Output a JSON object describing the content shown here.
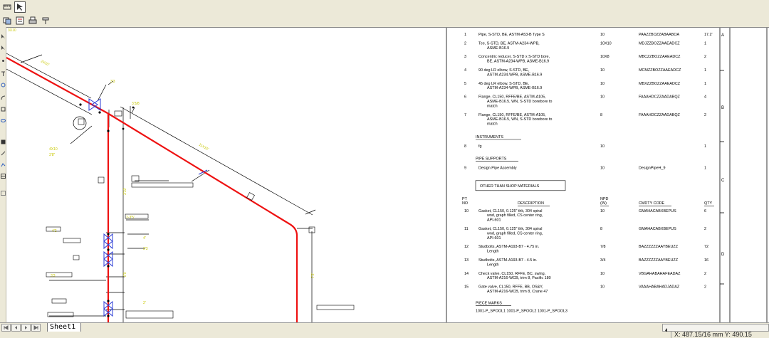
{
  "toolbar_top": {
    "icons": [
      "ruler-icon",
      "select-arrow-icon"
    ]
  },
  "toolbar_second": {
    "icons": [
      "layers-icon",
      "properties-icon",
      "print-icon",
      "pin-icon"
    ]
  },
  "sheet_tab": "Sheet1",
  "coordinates": "X: 487.15/16 mm   Y: 490.15",
  "iso_labels": [
    "3X10",
    "2X10'",
    "11X10'",
    "4X10",
    "3'3",
    "3'3/8",
    "3'8\"",
    "3'10'",
    "2-3'5'",
    "4'2",
    "4'",
    "3'3",
    "2'0",
    "3'3",
    "2'",
    "7'2'"
  ],
  "callouts": [
    "3",
    "5",
    "6",
    "12",
    "1",
    "7",
    "13",
    "14",
    "9",
    "11",
    "2"
  ],
  "bom": {
    "rows": [
      {
        "pt": "1",
        "desc": [
          "Pipe, S-STD, BE, ASTM-A53-B Type S"
        ],
        "npd": "10",
        "code": "PAAZZBOZZABAABOA",
        "qty": "17.2'"
      },
      {
        "pt": "2",
        "desc": [
          "Tee, S-STD, BE, ASTM-A234-WPB,",
          "ASME-B16.9"
        ],
        "npd": "10X10",
        "code": "MDJZZBOZZAAEADCZ",
        "qty": "1"
      },
      {
        "pt": "3",
        "desc": [
          "Concentric reducer, S-STD x S-STD bore,",
          "BE, ASTM-A234-WPB, ASME-B16.9"
        ],
        "npd": "10X8",
        "code": "MBCZZBOZZAAEADCZ",
        "qty": "2"
      },
      {
        "pt": "4",
        "desc": [
          "90 deg LR elbow, S-STD, BE,",
          "ASTM-A234-WPB, ASME-B16.9"
        ],
        "npd": "10",
        "code": "MCMZZBOZZAAEADCZ",
        "qty": "1"
      },
      {
        "pt": "5",
        "desc": [
          "45 deg LR elbow, S-STD, BE,",
          "ASTM-A234-WPB, ASME-B16.9"
        ],
        "npd": "10",
        "code": "MBXZZBOZZAAEADCZ",
        "qty": "1"
      },
      {
        "pt": "6",
        "desc": [
          "Flange, CL150, RFFE/BE, ASTM-A105,",
          "ASME-B16.5, WN, S-STD borebore to",
          "match"
        ],
        "npd": "10",
        "code": "FAAAHDCZZAADABQZ",
        "qty": "4"
      },
      {
        "pt": "7",
        "desc": [
          "Flange, CL150, RFFE/BE, ASTM-A105,",
          "ASME-B16.5, WN, S-STD borebore to",
          "match"
        ],
        "npd": "8",
        "code": "FAAAHDCZZAADABQZ",
        "qty": "2"
      }
    ],
    "instruments_title": "INSTRUMENTS",
    "instruments": [
      {
        "pt": "8",
        "desc": "fg",
        "npd": "10",
        "code": "",
        "qty": "1"
      }
    ],
    "supports_title": "PIPE SUPPORTS",
    "supports": [
      {
        "pt": "9",
        "desc": "Design Pipe Assembly",
        "npd": "10",
        "code": "DesignPipeH_9",
        "qty": "1"
      }
    ],
    "other_title": "OTHER THAN SHOP MATERIALS",
    "headers": {
      "pt": [
        "PT",
        "NO"
      ],
      "desc": "DESCRIPTION",
      "npd": [
        "NPD",
        "(IN)"
      ],
      "code": "CMDTY CODE",
      "qty": "QTY"
    },
    "other_rows": [
      {
        "pt": "10",
        "desc": [
          "Gasket, CL150, 0.125\" thk, 304 spiral",
          "wnd, graph filled, CS center ring,",
          "API-601"
        ],
        "npd": "10",
        "code": "GMAHACABXBEPUS",
        "qty": "6"
      },
      {
        "pt": "11",
        "desc": [
          "Gasket, CL150, 0.125\" thk, 304 spiral",
          "wnd, graph filled, CS center ring,",
          "API-601"
        ],
        "npd": "8",
        "code": "GMAHACABXBEPUS",
        "qty": "2"
      },
      {
        "pt": "12",
        "desc": [
          "Studbolts, ASTM-A193-B7 - 4.75 in.",
          "Length"
        ],
        "npd": "7/8",
        "code": "BAZZZZZZAAYBEUZZ",
        "qty": "72"
      },
      {
        "pt": "13",
        "desc": [
          "Studbolts, ASTM-A193-B7 - 4.5 in.",
          "Length"
        ],
        "npd": "3/4",
        "code": "BAZZZZZZAAYBEUZZ",
        "qty": "16"
      },
      {
        "pt": "14",
        "desc": [
          "Check valve, CL150, RFFE, BC, swing,",
          "ASTM-A216-WCB, trim 8, Pacific 180"
        ],
        "npd": "10",
        "code": "VBGAHABAHAFEADAZ",
        "qty": "2"
      },
      {
        "pt": "15",
        "desc": [
          "Gate valve, CL150, RFFE, BB, OS&Y,",
          "ASTM-A216-WCB, trim 8, Crane 47"
        ],
        "npd": "10",
        "code": "VAAAHABAHADJADAZ",
        "qty": "2"
      }
    ],
    "piece_marks_title": "PIECE MARKS",
    "piece_marks": "1001-P_SPOOL1 1001-P_SPOOL2 1001-P_SPOOL3"
  },
  "border_letters": [
    "A",
    "B",
    "C",
    "D"
  ],
  "colors": {
    "pipe": "#ee1111",
    "annotation": "#c8c800",
    "valve": "#2a3bd6",
    "dimension": "#000000"
  }
}
